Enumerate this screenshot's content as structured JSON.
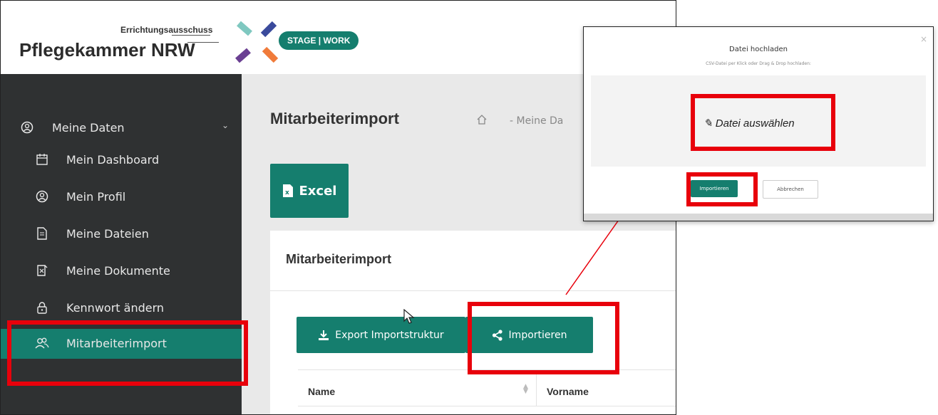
{
  "header": {
    "logo_small": "Errichtungsausschuss",
    "logo_big": "Pflegekammer NRW",
    "stage_badge": "STAGE | WORK"
  },
  "sidebar": {
    "section_label": "Meine Daten",
    "items": [
      {
        "label": "Mein Dashboard",
        "icon": "calendar-icon"
      },
      {
        "label": "Mein Profil",
        "icon": "user-icon"
      },
      {
        "label": "Meine Dateien",
        "icon": "file-icon"
      },
      {
        "label": "Meine Dokumente",
        "icon": "document-icon"
      },
      {
        "label": "Kennwort ändern",
        "icon": "lock-icon"
      },
      {
        "label": "Mitarbeiterimport",
        "icon": "users-icon",
        "active": true
      }
    ]
  },
  "main": {
    "page_title": "Mitarbeiterimport",
    "breadcrumb": "- Meine Da",
    "excel_label": "Excel",
    "panel_title": "Mitarbeiterimport",
    "export_label": "Export Importstruktur",
    "import_label": "Importieren",
    "table_headers": [
      "Name",
      "Vorname"
    ]
  },
  "modal": {
    "title": "Datei hochladen",
    "subtitle": "CSV-Datei per Klick oder Drag & Drop hochladen:",
    "dropzone_label": "Datei auswählen",
    "import_label": "Importieren",
    "cancel_label": "Abbrechen",
    "close_symbol": "×"
  },
  "colors": {
    "accent": "#157e6e",
    "sidebar": "#2f3132",
    "highlight": "#e8000b"
  }
}
